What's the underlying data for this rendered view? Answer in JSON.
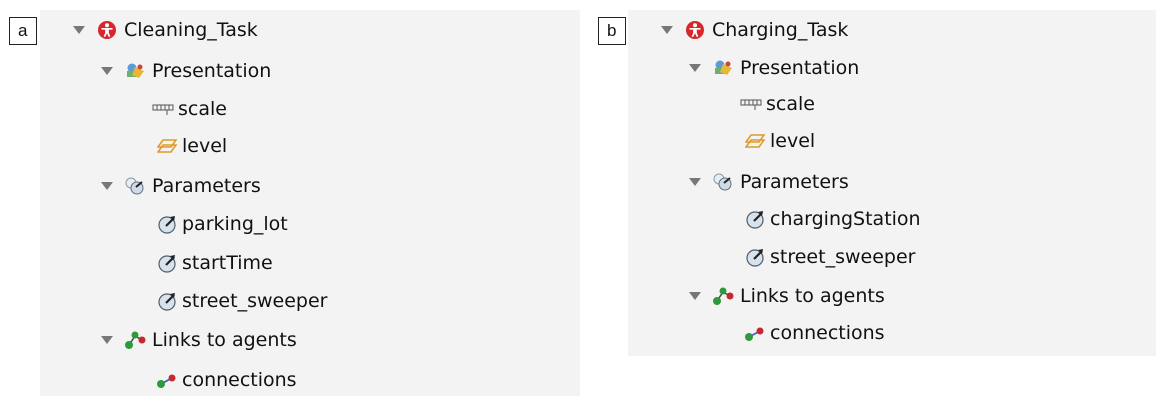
{
  "panels": [
    {
      "label": "a",
      "root": "Cleaning_Task",
      "presentation": {
        "label": "Presentation",
        "items": [
          "scale",
          "level"
        ]
      },
      "parameters": {
        "label": "Parameters",
        "items": [
          "parking_lot",
          "startTime",
          "street_sweeper"
        ]
      },
      "links": {
        "label": "Links to agents",
        "items": [
          "connections"
        ]
      }
    },
    {
      "label": "b",
      "root": "Charging_Task",
      "presentation": {
        "label": "Presentation",
        "items": [
          "scale",
          "level"
        ]
      },
      "parameters": {
        "label": "Parameters",
        "items": [
          "chargingStation",
          "street_sweeper"
        ]
      },
      "links": {
        "label": "Links to agents",
        "items": [
          "connections"
        ]
      }
    }
  ],
  "icons": {
    "expand": "triangle-down-icon",
    "root": "agent-icon",
    "presentation": "presentation-icon",
    "scale": "ruler-icon",
    "level": "level-icon",
    "parameters": "parameters-icon",
    "parameter": "parameter-icon",
    "links": "links-icon",
    "connection": "connection-icon"
  },
  "colors": {
    "tree_bg": "#f3f3f3",
    "agent_red": "#d9262c",
    "level_orange": "#e09a2a",
    "link_green": "#2e9a3b"
  }
}
